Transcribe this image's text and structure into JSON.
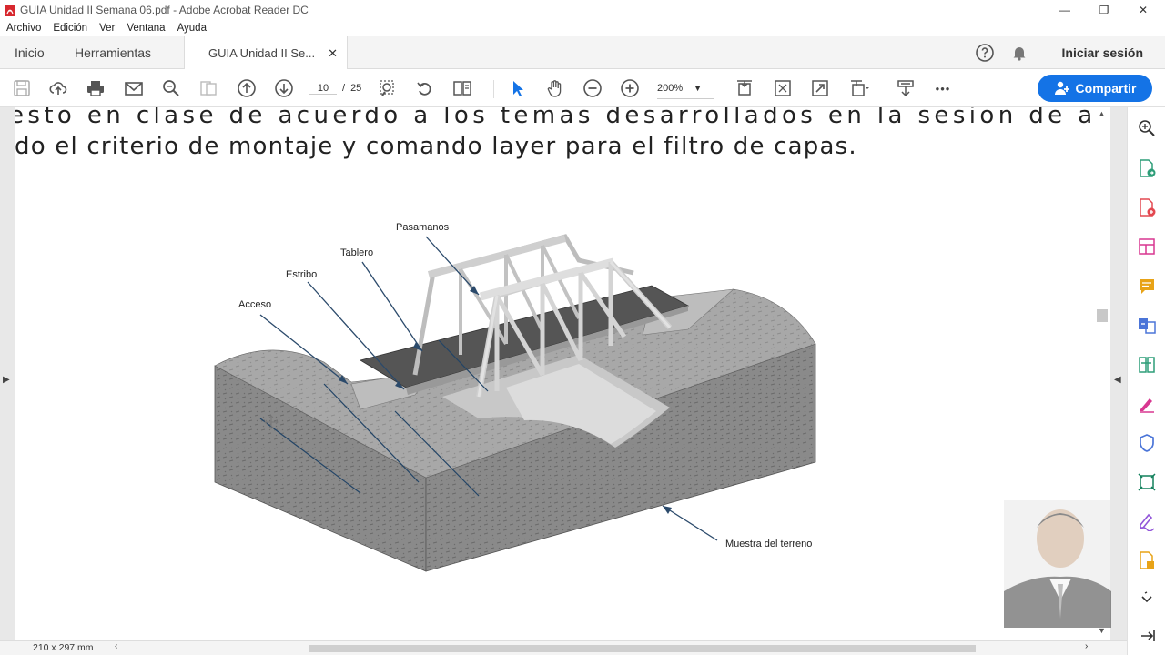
{
  "window": {
    "title": "GUIA Unidad II Semana 06.pdf - Adobe Acrobat Reader DC",
    "minimize": "—",
    "restore": "❐",
    "close": "✕"
  },
  "menu": [
    "Archivo",
    "Edición",
    "Ver",
    "Ventana",
    "Ayuda"
  ],
  "tabs": {
    "home": "Inicio",
    "tools": "Herramientas",
    "document": "GUIA Unidad II Se...",
    "close": "✕"
  },
  "header": {
    "signin": "Iniciar sesión"
  },
  "toolbar": {
    "page_current": "10",
    "page_separator": "/",
    "page_total": "25",
    "zoom": "200%",
    "more": "•••",
    "share_label": "Compartir"
  },
  "document": {
    "line1": "esto en clase de acuerdo a los temas desarrollados en la sesion de aprendizc",
    "line2": "do el criterio de montaje y comando layer para el filtro de capas.",
    "figure_labels": {
      "pasamanos": "Pasamanos",
      "tablero": "Tablero",
      "estribo": "Estribo",
      "acceso": "Acceso",
      "terreno": "Muestra del terreno"
    }
  },
  "status": {
    "page_size": "210 x 297 mm"
  },
  "colors": {
    "accent": "#1473e6",
    "pdf_red": "#d7282f"
  }
}
